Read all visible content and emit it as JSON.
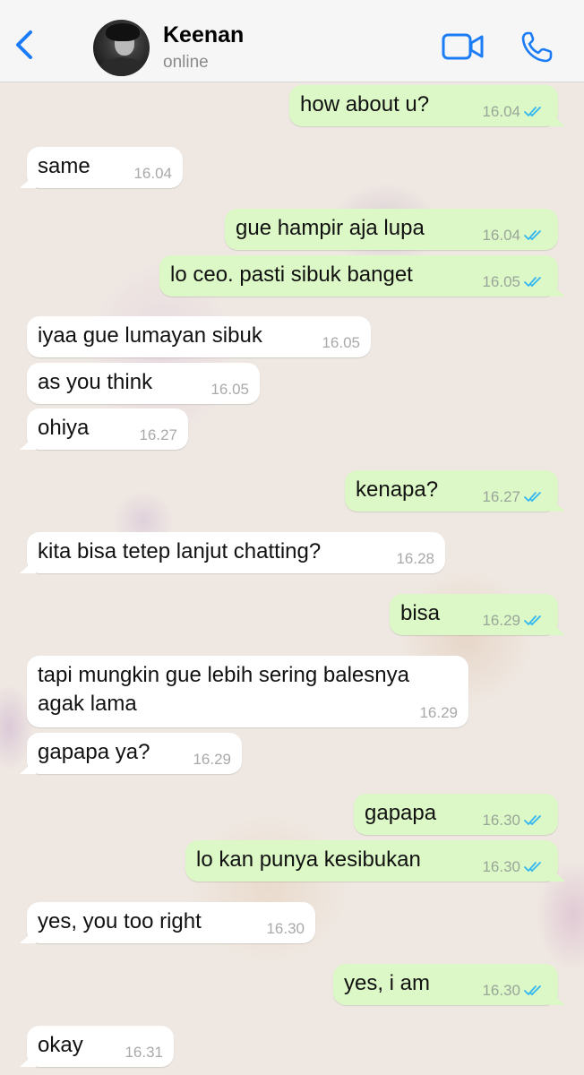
{
  "header": {
    "name": "Keenan",
    "status": "online",
    "back_icon": "chevron-left-icon",
    "video_icon": "video-camera-icon",
    "phone_icon": "phone-icon",
    "accent": "#1c7cf6"
  },
  "colors": {
    "incoming_bubble": "#ffffff",
    "outgoing_bubble": "#dcf8c6",
    "read_ticks": "#34b7f1"
  },
  "messages": [
    {
      "dir": "out",
      "text": "how about u?",
      "time": "16.04"
    },
    {
      "dir": "in",
      "text": "same",
      "time": "16.04"
    },
    {
      "dir": "out",
      "text": "gue hampir aja lupa",
      "time": "16.04"
    },
    {
      "dir": "out",
      "text": "lo ceo. pasti sibuk banget",
      "time": "16.05"
    },
    {
      "dir": "in",
      "text": "iyaa gue lumayan sibuk",
      "time": "16.05"
    },
    {
      "dir": "in",
      "text": "as you think",
      "time": "16.05"
    },
    {
      "dir": "in",
      "text": "ohiya",
      "time": "16.27"
    },
    {
      "dir": "out",
      "text": "kenapa?",
      "time": "16.27"
    },
    {
      "dir": "in",
      "text": "kita bisa tetep lanjut chatting?",
      "time": "16.28"
    },
    {
      "dir": "out",
      "text": "bisa",
      "time": "16.29"
    },
    {
      "dir": "in",
      "text": "tapi mungkin gue lebih sering balesnya\nagak lama",
      "time": "16.29"
    },
    {
      "dir": "in",
      "text": "gapapa ya?",
      "time": "16.29"
    },
    {
      "dir": "out",
      "text": "gapapa",
      "time": "16.30"
    },
    {
      "dir": "out",
      "text": "lo kan punya kesibukan",
      "time": "16.30"
    },
    {
      "dir": "in",
      "text": "yes, you too right",
      "time": "16.30"
    },
    {
      "dir": "out",
      "text": "yes, i am",
      "time": "16.30"
    },
    {
      "dir": "in",
      "text": "okay",
      "time": "16.31"
    }
  ]
}
